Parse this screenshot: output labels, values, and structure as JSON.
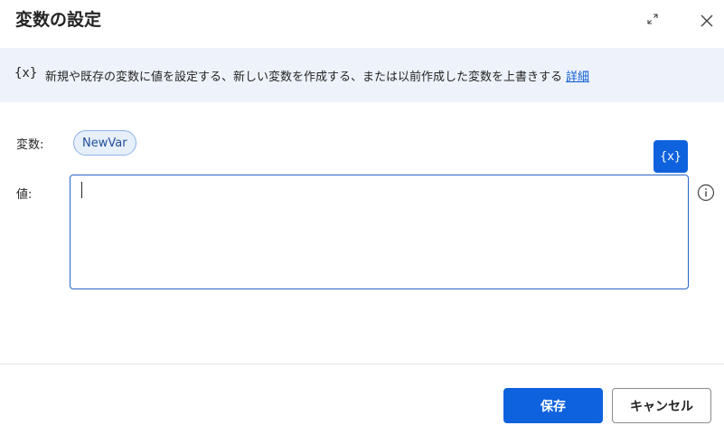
{
  "dialog": {
    "title": "変数の設定",
    "expand_icon": "expand-icon",
    "close_icon": "close-icon"
  },
  "info": {
    "icon_text": "{x}",
    "text": "新規や既存の変数に値を設定する、新しい変数を作成する、または以前作成した変数を上書きする",
    "link": "詳細"
  },
  "form": {
    "variable_label": "変数:",
    "variable_name": "NewVar",
    "value_label": "値:",
    "value_text": "",
    "insert_variable_label": "{x}",
    "info_icon": "info-circle-icon"
  },
  "footer": {
    "save_label": "保存",
    "cancel_label": "キャンセル"
  },
  "colors": {
    "accent": "#0f62de",
    "info_bar": "#eef3fb",
    "link": "#0f5ccf"
  }
}
